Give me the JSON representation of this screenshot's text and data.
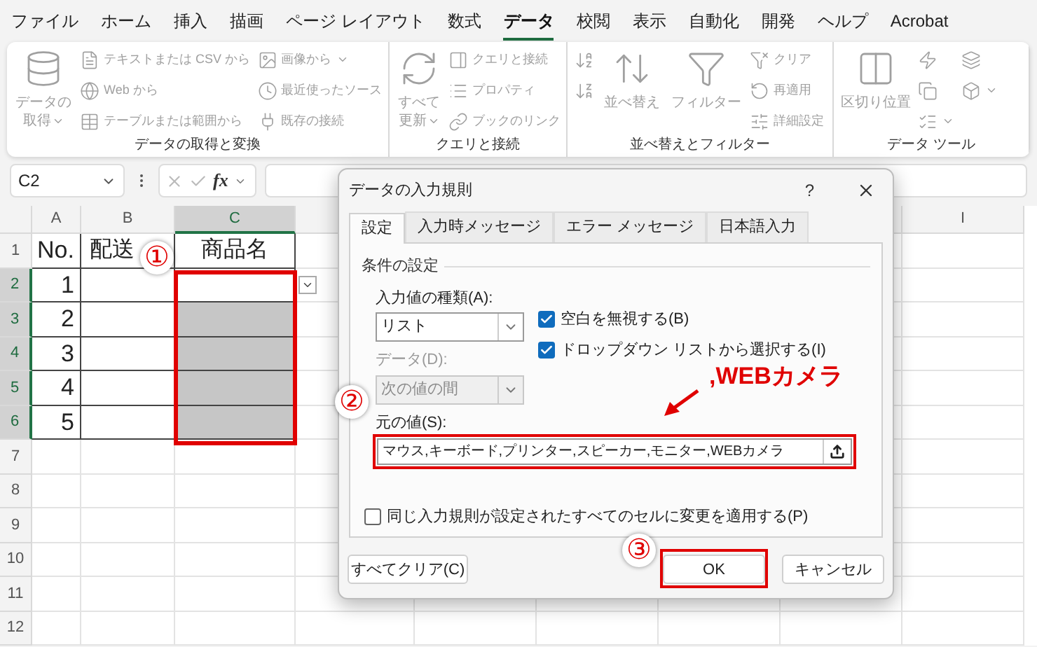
{
  "menu_tabs": [
    {
      "label": "ファイル",
      "selected": false
    },
    {
      "label": "ホーム",
      "selected": false
    },
    {
      "label": "挿入",
      "selected": false
    },
    {
      "label": "描画",
      "selected": false
    },
    {
      "label": "ページ レイアウト",
      "selected": false
    },
    {
      "label": "数式",
      "selected": false
    },
    {
      "label": "データ",
      "selected": true
    },
    {
      "label": "校閲",
      "selected": false
    },
    {
      "label": "表示",
      "selected": false
    },
    {
      "label": "自動化",
      "selected": false
    },
    {
      "label": "開発",
      "selected": false
    },
    {
      "label": "ヘルプ",
      "selected": false
    },
    {
      "label": "Acrobat",
      "selected": false
    }
  ],
  "ribbon": {
    "disabled": true,
    "groups": [
      {
        "label": "データの取得と変換",
        "items": [
          {
            "kind": "large",
            "label": "データの取得",
            "dropdown": true
          },
          {
            "kind": "small",
            "label": "テキストまたは CSV から"
          },
          {
            "kind": "small",
            "label": "Web から"
          },
          {
            "kind": "small",
            "label": "テーブルまたは範囲から"
          },
          {
            "kind": "small",
            "label": "画像から",
            "dropdown": true
          },
          {
            "kind": "small",
            "label": "最近使ったソース"
          },
          {
            "kind": "small",
            "label": "既存の接続"
          }
        ]
      },
      {
        "label": "クエリと接続",
        "items": [
          {
            "kind": "large",
            "label": "すべて更新",
            "dropdown": true
          },
          {
            "kind": "small",
            "label": "クエリと接続"
          },
          {
            "kind": "small",
            "label": "プロパティ"
          },
          {
            "kind": "small",
            "label": "ブックのリンク"
          }
        ]
      },
      {
        "label": "並べ替えとフィルター",
        "items": [
          {
            "kind": "icon"
          },
          {
            "kind": "icon"
          },
          {
            "kind": "large",
            "label": "並べ替え"
          },
          {
            "kind": "large",
            "label": "フィルター"
          },
          {
            "kind": "small",
            "label": "クリア"
          },
          {
            "kind": "small",
            "label": "再適用"
          },
          {
            "kind": "small",
            "label": "詳細設定"
          }
        ]
      },
      {
        "label": "データ ツール",
        "items": [
          {
            "kind": "large",
            "label": "区切り位置"
          },
          {
            "kind": "icon"
          },
          {
            "kind": "icon"
          },
          {
            "kind": "icon",
            "dropdown": true
          },
          {
            "kind": "icon"
          },
          {
            "kind": "icon",
            "dropdown": true
          }
        ]
      }
    ]
  },
  "formula_bar": {
    "name_box": "C2",
    "fx": "fx"
  },
  "sheet": {
    "columns": [
      {
        "label": "A",
        "selected": false
      },
      {
        "label": "B",
        "selected": false
      },
      {
        "label": "C",
        "selected": true
      },
      {
        "label": "I",
        "selected": false
      }
    ],
    "rows": [
      {
        "number": "1",
        "selected": false,
        "bordered": true,
        "a": "No.",
        "b": "配送",
        "c": "商品名"
      },
      {
        "number": "2",
        "selected": true,
        "bordered": true,
        "a": "1",
        "c_selected": true,
        "c_active": true,
        "dropdown": true
      },
      {
        "number": "3",
        "selected": true,
        "bordered": true,
        "a": "2",
        "c_selected": true,
        "c_active": false
      },
      {
        "number": "4",
        "selected": true,
        "bordered": true,
        "a": "3",
        "c_selected": true,
        "c_active": false
      },
      {
        "number": "5",
        "selected": true,
        "bordered": true,
        "a": "4",
        "c_selected": true,
        "c_active": false
      },
      {
        "number": "6",
        "selected": true,
        "bordered": true,
        "a": "5",
        "c_selected": true,
        "c_active": false
      },
      {
        "number": "7",
        "selected": false
      },
      {
        "number": "8",
        "selected": false
      },
      {
        "number": "9",
        "selected": false
      },
      {
        "number": "10",
        "selected": false
      },
      {
        "number": "11",
        "selected": false
      },
      {
        "number": "12",
        "selected": false
      }
    ]
  },
  "dialog": {
    "title": "データの入力規則",
    "help": "?",
    "tabs": [
      {
        "label": "設定",
        "selected": true
      },
      {
        "label": "入力時メッセージ",
        "selected": false
      },
      {
        "label": "エラー メッセージ",
        "selected": false
      },
      {
        "label": "日本語入力",
        "selected": false
      }
    ],
    "section": "条件の設定",
    "allow": {
      "label": "入力値の種類(A):",
      "value": "リスト",
      "disabled": false
    },
    "data": {
      "label": "データ(D):",
      "value": "次の値の間",
      "disabled": true
    },
    "checkboxes": [
      {
        "label": "空白を無視する(B)",
        "checked": true
      },
      {
        "label": "ドロップダウン リストから選択する(I)",
        "checked": true
      }
    ],
    "source": {
      "label": "元の値(S):",
      "value": "マウス,キーボード,プリンター,スピーカー,モニター,WEBカメラ"
    },
    "apply_all": {
      "label": "同じ入力規則が設定されたすべてのセルに変更を適用する(P)",
      "checked": false
    },
    "buttons": [
      {
        "label": "すべてクリア(C)",
        "kind": "clear"
      },
      {
        "label": "OK",
        "kind": "ok"
      },
      {
        "label": "キャンセル",
        "kind": "cancel"
      }
    ]
  },
  "annotations": {
    "markers": [
      "①",
      "②",
      "③"
    ],
    "callout": ",WEBカメラ"
  }
}
